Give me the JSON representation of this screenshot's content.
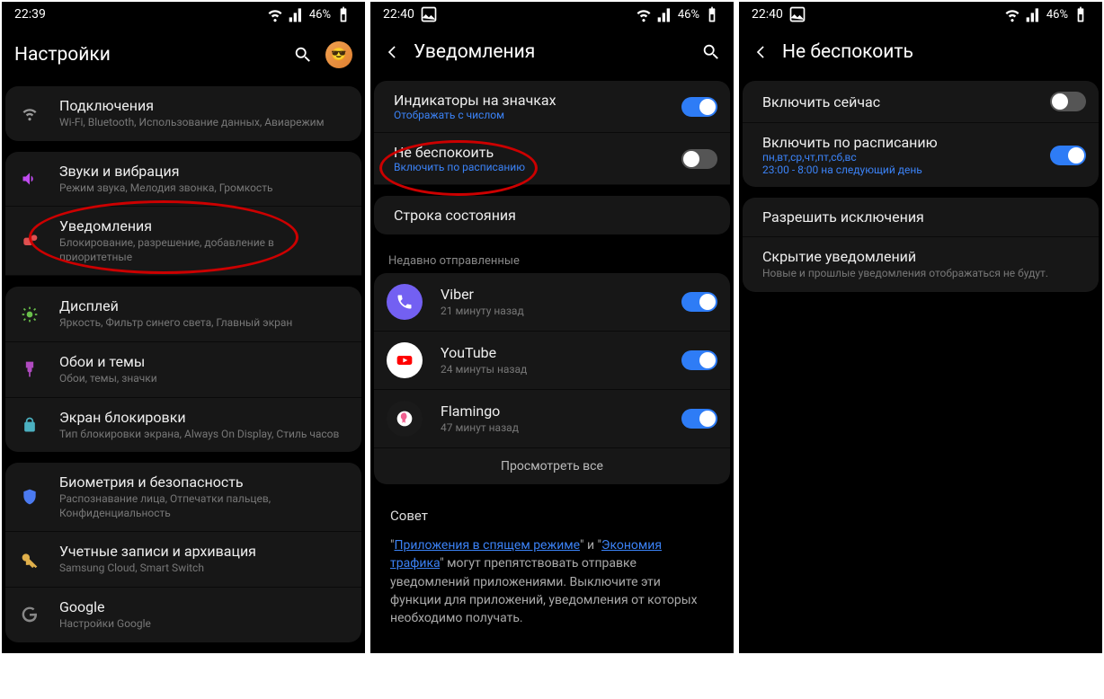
{
  "screen1": {
    "status": {
      "time": "22:39",
      "battery": "46%"
    },
    "title": "Настройки",
    "groups": [
      [
        {
          "title": "Подключения",
          "sub": "Wi-Fi, Bluetooth, Использование данных, Авиарежим"
        }
      ],
      [
        {
          "title": "Звуки и вибрация",
          "sub": "Режим звука, Мелодия звонка, Громкость"
        },
        {
          "title": "Уведомления",
          "sub": "Блокирование, разрешение, добавление в приоритетные"
        }
      ],
      [
        {
          "title": "Дисплей",
          "sub": "Яркость, Фильтр синего света, Главный экран"
        },
        {
          "title": "Обои и темы",
          "sub": "Обои, темы, значки"
        },
        {
          "title": "Экран блокировки",
          "sub": "Тип блокировки экрана, Always On Display, Стиль часов"
        }
      ],
      [
        {
          "title": "Биометрия и безопасность",
          "sub": "Распознавание лица, Отпечатки пальцев, Конфиденциальность"
        },
        {
          "title": "Учетные записи и архивация",
          "sub": "Samsung Cloud, Smart Switch"
        },
        {
          "title": "Google",
          "sub": "Настройки Google"
        }
      ]
    ]
  },
  "screen2": {
    "status": {
      "time": "22:40",
      "battery": "46%"
    },
    "title": "Уведомления",
    "items": {
      "badges": {
        "title": "Индикаторы на значках",
        "sub": "Отображать с числом"
      },
      "dnd": {
        "title": "Не беспокоить",
        "sub": "Включить по расписанию"
      },
      "statusbar": {
        "title": "Строка состояния"
      }
    },
    "recent_label": "Недавно отправленные",
    "recent": [
      {
        "name": "Viber",
        "sub": "21 минуту назад"
      },
      {
        "name": "YouTube",
        "sub": "24 минуты назад"
      },
      {
        "name": "Flamingo",
        "sub": "47 минут назад"
      }
    ],
    "view_all": "Просмотреть все",
    "advice": {
      "title": "Совет",
      "link1": "Приложения в спящем режиме",
      "mid1": "\" и \"",
      "link2": "Экономия трафика",
      "rest": "\" могут препятствовать отправке уведомлений приложениями. Выключите эти функции для приложений, уведомления от которых необходимо получать."
    }
  },
  "screen3": {
    "status": {
      "time": "22:40",
      "battery": "46%"
    },
    "title": "Не беспокоить",
    "items": {
      "now": {
        "title": "Включить сейчас"
      },
      "schedule": {
        "title": "Включить по расписанию",
        "sub1": "пн,вт,ср,чт,пт,сб,вс",
        "sub2": "23:00 - 8:00 на следующий день"
      },
      "exceptions": {
        "title": "Разрешить исключения"
      },
      "hide": {
        "title": "Скрытие уведомлений",
        "sub": "Новые и прошлые уведомления отображаться не будут."
      }
    }
  }
}
